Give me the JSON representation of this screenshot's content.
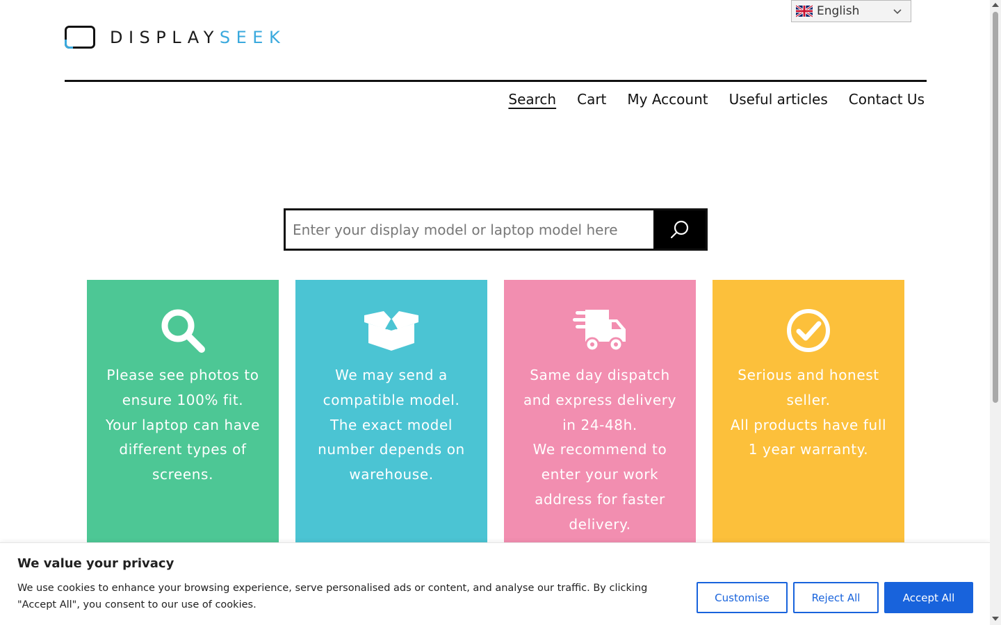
{
  "language": {
    "selected": "English",
    "flag_icon": "uk-flag-icon"
  },
  "logo": {
    "part1": "DISPLAY",
    "part2": "SEEK",
    "accent_color": "#3aa9dd"
  },
  "nav": {
    "items": [
      {
        "label": "Search",
        "active": true
      },
      {
        "label": "Cart"
      },
      {
        "label": "My Account"
      },
      {
        "label": "Useful articles"
      },
      {
        "label": "Contact Us"
      }
    ]
  },
  "search": {
    "placeholder": "Enter your display model or laptop model here",
    "value": "",
    "button_icon": "search-icon"
  },
  "cards": [
    {
      "icon": "magnifier-icon",
      "color": "#4dc795",
      "lines": [
        "Please see photos to ensure 100% fit.",
        "Your laptop can have different types of screens."
      ]
    },
    {
      "icon": "open-box-icon",
      "color": "#4bc4d3",
      "lines": [
        "We may send a compatible model.",
        "The exact model number depends on warehouse."
      ]
    },
    {
      "icon": "fast-truck-icon",
      "color": "#f28eb0",
      "lines": [
        "Same day dispatch and express delivery in 24-48h.",
        "We recommend to enter your work address for faster delivery."
      ]
    },
    {
      "icon": "check-circle-icon",
      "color": "#fcc03b",
      "lines": [
        "Serious and honest seller.",
        "All products have full 1 year warranty."
      ]
    }
  ],
  "cookie": {
    "title": "We value your privacy",
    "text": "We use cookies to enhance your browsing experience, serve personalised ads or content, and analyse our traffic. By clicking \"Accept All\", you consent to our use of cookies.",
    "customise": "Customise",
    "reject": "Reject All",
    "accept": "Accept All",
    "accent_color": "#1863dc"
  }
}
